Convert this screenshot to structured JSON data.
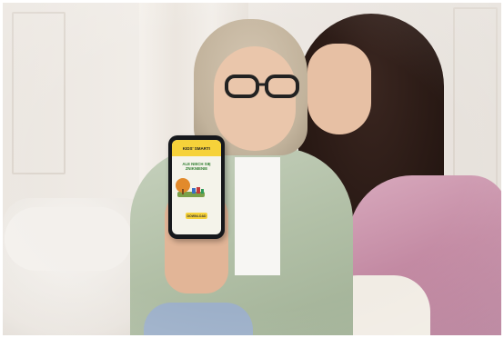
{
  "phone_app": {
    "header_text": "KIDS' SMART!",
    "title_text": "ALE NIECH SIĘ ZNIKNIENIE",
    "button_text": "DOWNLOAD"
  },
  "colors": {
    "app_accent": "#f6d23a",
    "app_title": "#2f7d2f",
    "jacket_green": "#b2c0a7",
    "jacket_pink": "#c38aa3"
  }
}
